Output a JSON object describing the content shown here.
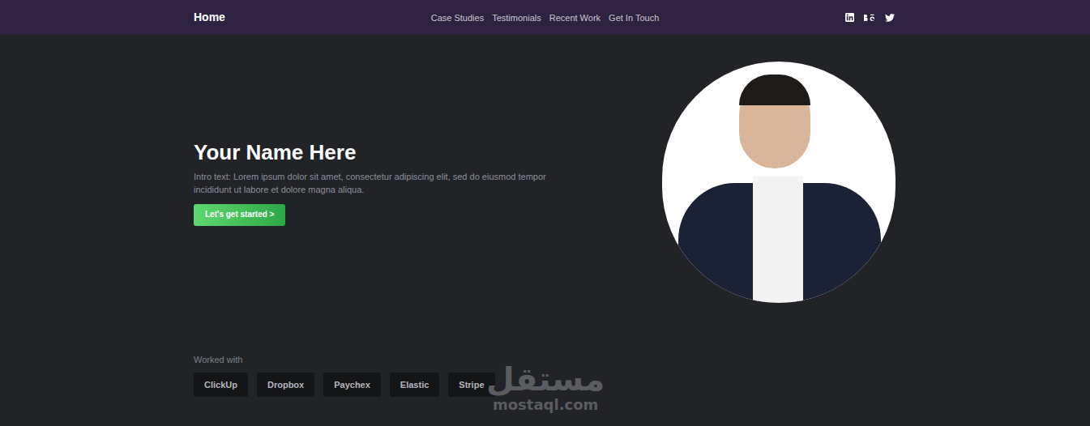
{
  "nav": {
    "brand": "Home",
    "links": [
      "Case Studies",
      "Testimonials",
      "Recent Work",
      "Get In Touch"
    ]
  },
  "hero": {
    "title": "Your Name Here",
    "intro": "Intro text: Lorem ipsum dolor sit amet, consectetur adipiscing elit, sed do eiusmod tempor incididunt ut labore et dolore magna aliqua.",
    "button": "Let's get started >"
  },
  "worked_with": {
    "label": "Worked with",
    "companies": [
      "ClickUp",
      "Dropbox",
      "Paychex",
      "Elastic",
      "Stripe"
    ]
  },
  "watermark": {
    "arabic": "مستقل",
    "latin": "mostaql.com"
  }
}
